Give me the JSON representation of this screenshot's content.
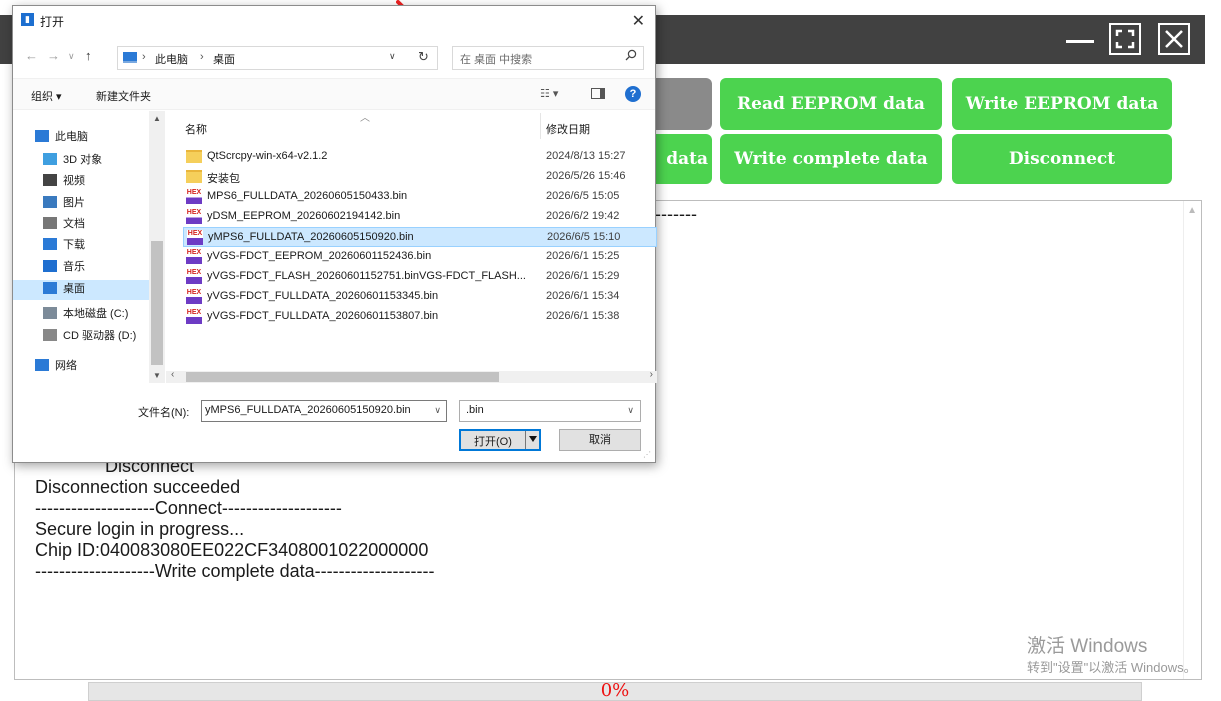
{
  "app": {
    "buttons": {
      "read_eeprom": "Read EEPROM data",
      "write_eeprom": "Write EEPROM data",
      "data_fragment": "data",
      "write_complete": "Write complete data",
      "disconnect": "Disconnect"
    },
    "log": {
      "top_dashes": "-------",
      "lines": [
        "              Disconnect",
        "Disconnection succeeded",
        "--------------------Connect--------------------",
        "Secure login in progress...",
        "Chip ID:040083080EE022CF3408001022000000",
        "--------------------Write complete data--------------------"
      ]
    },
    "watermark": {
      "line1": "激活 Windows",
      "line2": "转到\"设置\"以激活 Windows。"
    },
    "progress": {
      "label": "0%",
      "value": 0
    },
    "colors": {
      "green": "#4cd34f",
      "titlebar": "#414141",
      "progress_text": "#ee1111"
    }
  },
  "dialog": {
    "title": "打开",
    "breadcrumb": [
      "此电脑",
      "桌面"
    ],
    "search_placeholder": "在 桌面 中搜索",
    "toolbar": {
      "organize": "组织 ▾",
      "new_folder": "新建文件夹"
    },
    "nav_items": [
      {
        "label": "此电脑",
        "icon": "pc-icon"
      },
      {
        "label": "3D 对象",
        "icon": "cube-icon"
      },
      {
        "label": "视频",
        "icon": "video-icon"
      },
      {
        "label": "图片",
        "icon": "picture-icon"
      },
      {
        "label": "文档",
        "icon": "document-icon"
      },
      {
        "label": "下载",
        "icon": "download-icon"
      },
      {
        "label": "音乐",
        "icon": "music-icon"
      },
      {
        "label": "桌面",
        "icon": "desktop-icon"
      },
      {
        "label": "本地磁盘 (C:)",
        "icon": "drive-icon"
      },
      {
        "label": "CD 驱动器 (D:)",
        "icon": "cd-icon"
      },
      {
        "label": "网络",
        "icon": "network-icon"
      }
    ],
    "columns": {
      "name": "名称",
      "date": "修改日期"
    },
    "files": [
      {
        "name": "QtScrcpy-win-x64-v2.1.2",
        "date": "2024/8/13 15:27",
        "type": "folder"
      },
      {
        "name": "安装包",
        "date": "2026/5/26 15:46",
        "type": "folder"
      },
      {
        "name": "MPS6_FULLDATA_20260605150433.bin",
        "date": "2026/6/5 15:05",
        "type": "hex"
      },
      {
        "name": "yDSM_EEPROM_20260602194142.bin",
        "date": "2026/6/2 19:42",
        "type": "hex"
      },
      {
        "name": "yMPS6_FULLDATA_20260605150920.bin",
        "date": "2026/6/5 15:10",
        "type": "hex",
        "selected": true
      },
      {
        "name": "yVGS-FDCT_EEPROM_20260601152436.bin",
        "date": "2026/6/1 15:25",
        "type": "hex"
      },
      {
        "name": "yVGS-FDCT_FLASH_20260601152751.binVGS-FDCT_FLASH...",
        "date": "2026/6/1 15:29",
        "type": "hex"
      },
      {
        "name": "yVGS-FDCT_FULLDATA_20260601153345.bin",
        "date": "2026/6/1 15:34",
        "type": "hex"
      },
      {
        "name": "yVGS-FDCT_FULLDATA_20260601153807.bin",
        "date": "2026/6/1 15:38",
        "type": "hex"
      }
    ],
    "filename_label": "文件名(N):",
    "filename_value": "yMPS6_FULLDATA_20260605150920.bin",
    "filetype_value": ".bin",
    "open_button": "打开(O)",
    "cancel_button": "取消"
  }
}
